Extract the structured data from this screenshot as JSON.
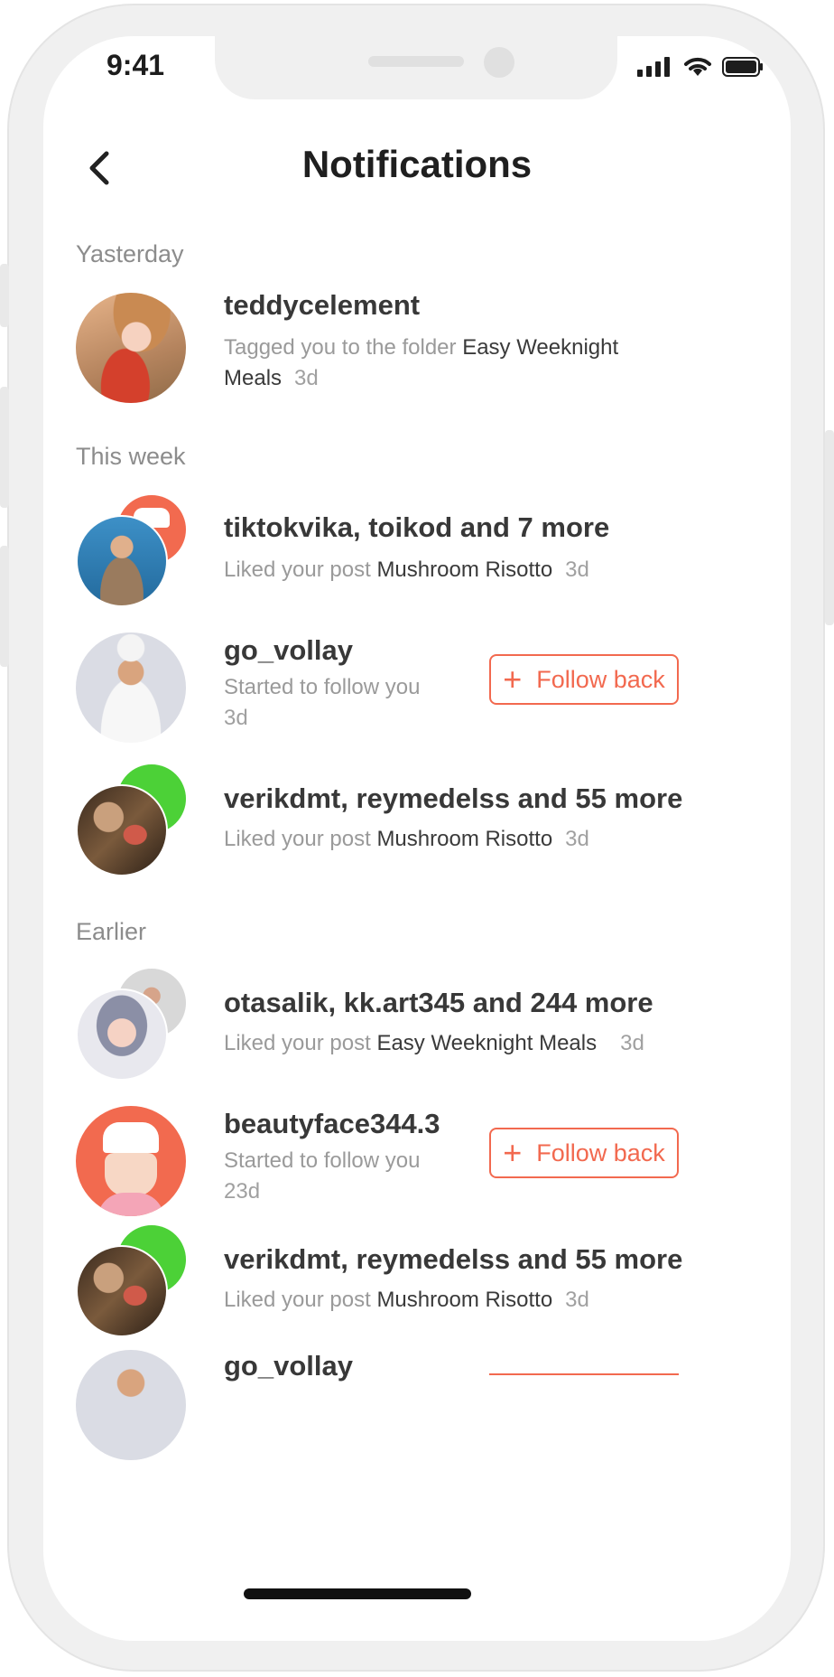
{
  "status_bar": {
    "time": "9:41"
  },
  "header": {
    "title": "Notifications"
  },
  "sections": {
    "yesterday": "Yasterday",
    "this_week": "This week",
    "earlier": "Earlier"
  },
  "notifications": [
    {
      "user": "teddycelement",
      "text": "Tagged you to the folder ",
      "target": "Easy Weeknight Meals",
      "time": "3d"
    },
    {
      "user": "tiktokvika, toikod and 7 more",
      "text": "Liked your post ",
      "target": "Mushroom Risotto",
      "time": "3d"
    },
    {
      "user": "go_vollay",
      "text": "Started to follow you",
      "time": "3d",
      "button": "Follow back"
    },
    {
      "user": "verikdmt, reymedelss and 55 more",
      "text": "Liked your post ",
      "target": "Mushroom Risotto",
      "time": "3d"
    },
    {
      "user": "otasalik, kk.art345 and 244 more",
      "text": "Liked your post ",
      "target": "Easy Weeknight Meals",
      "time": "3d"
    },
    {
      "user": "beautyface344.3",
      "text": "Started to follow you",
      "time": "23d",
      "button": "Follow back"
    },
    {
      "user": "verikdmt, reymedelss and 55 more",
      "text": "Liked your post ",
      "target": "Mushroom Risotto",
      "time": "3d"
    },
    {
      "user": "go_vollay"
    }
  ],
  "colors": {
    "accent": "#f2694f",
    "green": "#4cd137",
    "text": "#383838",
    "muted": "#9a9a9a"
  }
}
